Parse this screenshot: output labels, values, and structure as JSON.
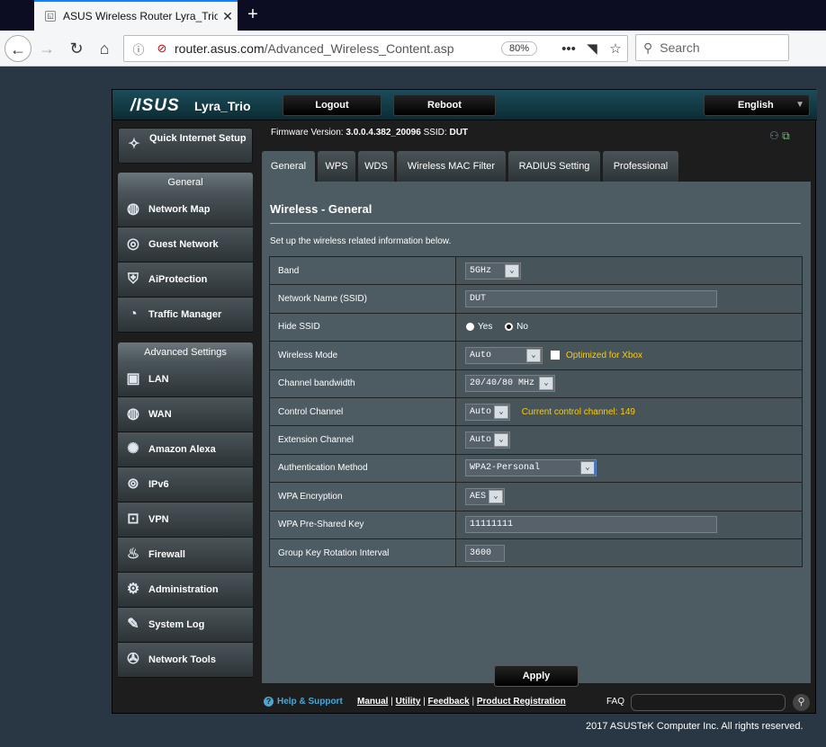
{
  "browser": {
    "tab_title": "ASUS Wireless Router Lyra_Trio",
    "url_host": "router.asus.com",
    "url_path": "/Advanced_Wireless_Content.asp",
    "zoom": "80%",
    "search_placeholder": "Search"
  },
  "router": {
    "logo": "/ISUS",
    "model": "Lyra_Trio",
    "logout_label": "Logout",
    "reboot_label": "Reboot",
    "language": "English",
    "firmware_label": "Firmware Version:",
    "firmware_value": "3.0.0.4.382_20096",
    "ssid_label": "SSID:",
    "ssid_value": "DUT"
  },
  "sidebar": {
    "quick_setup": "Quick Internet Setup",
    "general_header": "General",
    "general_items": [
      "Network Map",
      "Guest Network",
      "AiProtection",
      "Traffic Manager"
    ],
    "advanced_header": "Advanced Settings",
    "advanced_items": [
      "LAN",
      "WAN",
      "Amazon Alexa",
      "IPv6",
      "VPN",
      "Firewall",
      "Administration",
      "System Log",
      "Network Tools"
    ]
  },
  "tabs": [
    "General",
    "WPS",
    "WDS",
    "Wireless MAC Filter",
    "RADIUS Setting",
    "Professional"
  ],
  "page": {
    "title": "Wireless - General",
    "description": "Set up the wireless related information below."
  },
  "form": {
    "band_label": "Band",
    "band_value": "5GHz",
    "ssid_label": "Network Name (SSID)",
    "ssid_value": "DUT",
    "hide_label": "Hide SSID",
    "hide_yes": "Yes",
    "hide_no": "No",
    "mode_label": "Wireless Mode",
    "mode_value": "Auto",
    "xbox_label": "Optimized for Xbox",
    "bw_label": "Channel bandwidth",
    "bw_value": "20/40/80 MHz",
    "cc_label": "Control Channel",
    "cc_value": "Auto",
    "cc_note": "Current control channel: 149",
    "ext_label": "Extension Channel",
    "ext_value": "Auto",
    "auth_label": "Authentication Method",
    "auth_value": "WPA2-Personal",
    "enc_label": "WPA Encryption",
    "enc_value": "AES",
    "psk_label": "WPA Pre-Shared Key",
    "psk_value": "11111111",
    "rot_label": "Group Key Rotation Interval",
    "rot_value": "3600"
  },
  "apply_label": "Apply",
  "footer": {
    "help": "Help & Support",
    "manual": "Manual",
    "utility": "Utility",
    "feedback": "Feedback",
    "registration": "Product Registration",
    "faq": "FAQ",
    "copyright": "2017 ASUSTeK Computer Inc. All rights reserved."
  }
}
